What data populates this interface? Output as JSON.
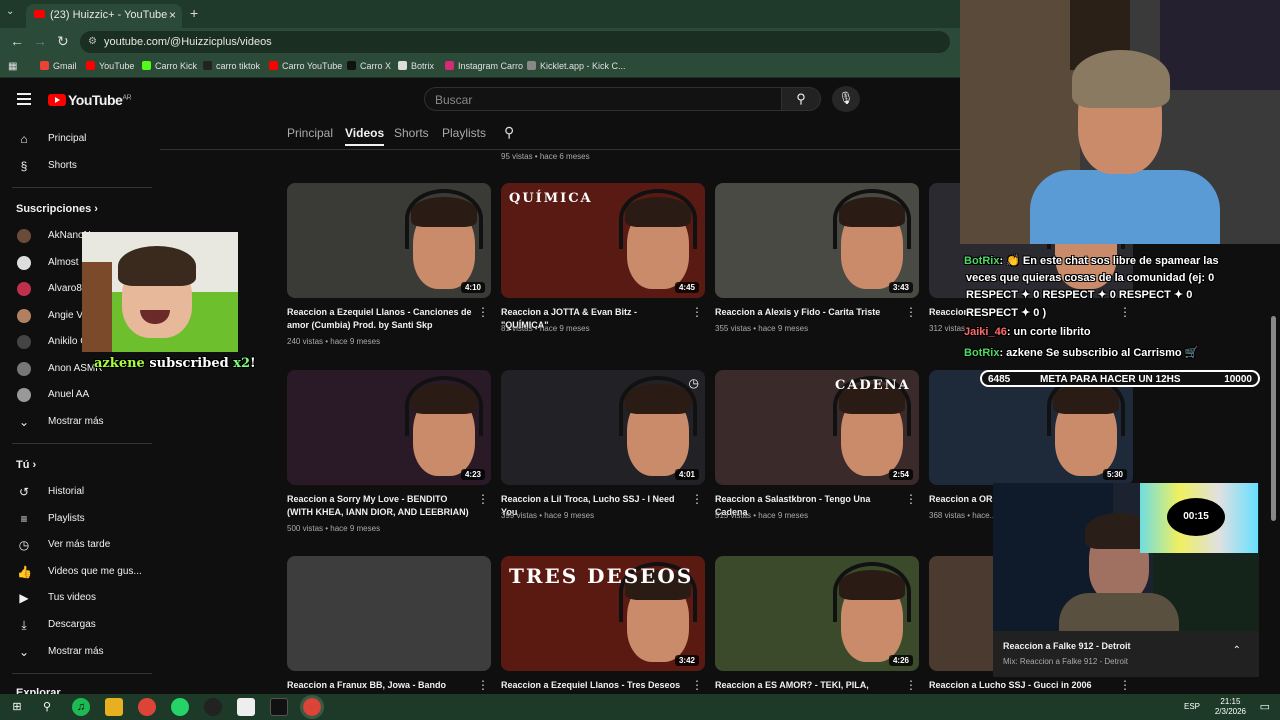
{
  "browser": {
    "tab_title": "(23) Huizzic+ - YouTube",
    "url": "youtube.com/@Huizzicplus/videos",
    "bookmarks": [
      {
        "label": "Gmail",
        "color": "#ea4335"
      },
      {
        "label": "YouTube",
        "color": "#ff0000"
      },
      {
        "label": "Carro Kick",
        "color": "#53fc18"
      },
      {
        "label": "carro tiktok",
        "color": "#222222"
      },
      {
        "label": "Carro YouTube",
        "color": "#ff0000"
      },
      {
        "label": "Carro X",
        "color": "#111111"
      },
      {
        "label": "Botrix",
        "color": "#dddddd"
      },
      {
        "label": "Instagram Carro",
        "color": "#d62976"
      },
      {
        "label": "Kicklet.app - Kick C...",
        "color": "#888888"
      }
    ]
  },
  "yt": {
    "logo": "YouTube",
    "region": "AR",
    "search_placeholder": "Buscar"
  },
  "sidebar": {
    "main": [
      {
        "label": "Principal",
        "icon": "home-icon",
        "glyph": "⌂"
      },
      {
        "label": "Shorts",
        "icon": "shorts-icon",
        "glyph": "§"
      }
    ],
    "subs_header": "Suscripciones",
    "subs": [
      {
        "label": "AkNanoN",
        "color": "#6b4a3a"
      },
      {
        "label": "Almost F",
        "color": "#dddddd"
      },
      {
        "label": "Alvaro84",
        "color": "#c0304a"
      },
      {
        "label": "Angie Ve",
        "color": "#b08060"
      },
      {
        "label": "Anikilo C",
        "color": "#444444"
      },
      {
        "label": "Anon ASMR",
        "color": "#777777"
      },
      {
        "label": "Anuel AA",
        "color": "#999999"
      }
    ],
    "more_subs": "Mostrar más",
    "you_header": "Tú",
    "you": [
      {
        "label": "Historial",
        "icon": "history-icon",
        "glyph": "↺"
      },
      {
        "label": "Playlists",
        "icon": "playlists-icon",
        "glyph": "≡"
      },
      {
        "label": "Ver más tarde",
        "icon": "watch-later-icon",
        "glyph": "◷"
      },
      {
        "label": "Videos que me gus...",
        "icon": "like-icon",
        "glyph": "👍"
      },
      {
        "label": "Tus videos",
        "icon": "your-videos-icon",
        "glyph": "▶"
      },
      {
        "label": "Descargas",
        "icon": "downloads-icon",
        "glyph": "⤓"
      }
    ],
    "more_you": "Mostrar más",
    "explore": "Explorar"
  },
  "channel_tabs": [
    "Principal",
    "Videos",
    "Shorts",
    "Playlists"
  ],
  "prev_meta": "95 vistas • hace 6 meses",
  "videos": [
    {
      "title": "Reaccion a Ezequiel Llanos - Canciones de amor (Cumbia) Prod. by Santi Skp",
      "meta": "240 vistas • hace 9 meses",
      "duration": "4:10",
      "bg": "#3a3a36"
    },
    {
      "title": "Reaccion a JOTTA & Evan Bitz - \"QUÍMICA\"",
      "meta": "81 vistas • hace 9 meses",
      "duration": "4:45",
      "bg": "#5a1a14"
    },
    {
      "title": "Reaccion a Alexis y Fido - Carita Triste",
      "meta": "355 vistas • hace 9 meses",
      "duration": "3:43",
      "bg": "#4a4a44"
    },
    {
      "title": "Reaccion a ...",
      "meta": "312 vistas",
      "duration": "",
      "bg": "#2a2a30"
    },
    {
      "title": "Reaccion a Sorry My Love - BENDITO (WITH KHEA, IANN DIOR, AND LEEBRIAN)",
      "meta": "500 vistas • hace 9 meses",
      "duration": "4:23",
      "bg": "#2a1a28"
    },
    {
      "title": "Reaccion a Lil Troca, Lucho SSJ - I Need You",
      "meta": "399 vistas • hace 9 meses",
      "duration": "4:01",
      "bg": "#222226"
    },
    {
      "title": "Reaccion a Salastkbron - Tengo Una Cadena",
      "meta": "515 vistas • hace 9 meses",
      "duration": "2:54",
      "bg": "#3a2a2a"
    },
    {
      "title": "Reaccion a ORO... Pablo Chill-E, D...",
      "meta": "368 vistas • hace...",
      "duration": "5:30",
      "bg": "#1e2a3a"
    },
    {
      "title": "Reaccion a Franux BB, Jowa - Bando",
      "meta": "",
      "duration": "",
      "bg": "#3d3d3d"
    },
    {
      "title": "Reaccion a Ezequiel Llanos - Tres Deseos",
      "meta": "",
      "duration": "3:42",
      "bg": "#5a1a12"
    },
    {
      "title": "Reaccion a ES AMOR? - TEKI, PILA, Quiroga",
      "meta": "",
      "duration": "4:26",
      "bg": "#3a4a2a"
    },
    {
      "title": "Reaccion a Lucho SSJ - Gucci in 2006",
      "meta": "",
      "duration": "",
      "bg": "#4a3a30"
    }
  ],
  "thumb_text": {
    "quimica": "QUÍMICA",
    "tres_deseos": "TRES DESEOS",
    "cadena": "CADENA"
  },
  "stream": {
    "chat": [
      {
        "user": "BotRix",
        "msg": ": 👏 En este chat sos libre de spamear las"
      },
      {
        "user": "",
        "msg": "veces que quieras cosas de la comunidad (ej: 0"
      },
      {
        "user": "",
        "msg": "RESPECT ✦ 0 RESPECT ✦ 0 RESPECT ✦ 0"
      },
      {
        "user": "",
        "msg": "RESPECT ✦ 0 )"
      },
      {
        "user": "Jaiki_46",
        "msg": ": un corte librito"
      },
      {
        "user": "BotRix",
        "msg": ": azkene Se subscribio al Carrismo 🛒"
      }
    ],
    "goal": {
      "start": "6485",
      "label": "META PARA HACER UN 12HS",
      "end": "10000"
    },
    "sub_user": "azkene",
    "sub_text": "subscribed",
    "sub_mult": "x2",
    "timer": "00:15"
  },
  "miniplayer": {
    "title": "Reaccion a Falke 912 - Detroit",
    "subtitle": "Mix: Reaccion a Falke 912 - Detroit"
  },
  "taskbar": {
    "lang": "ESP",
    "time": "21:15",
    "date": "2/3/2026"
  }
}
